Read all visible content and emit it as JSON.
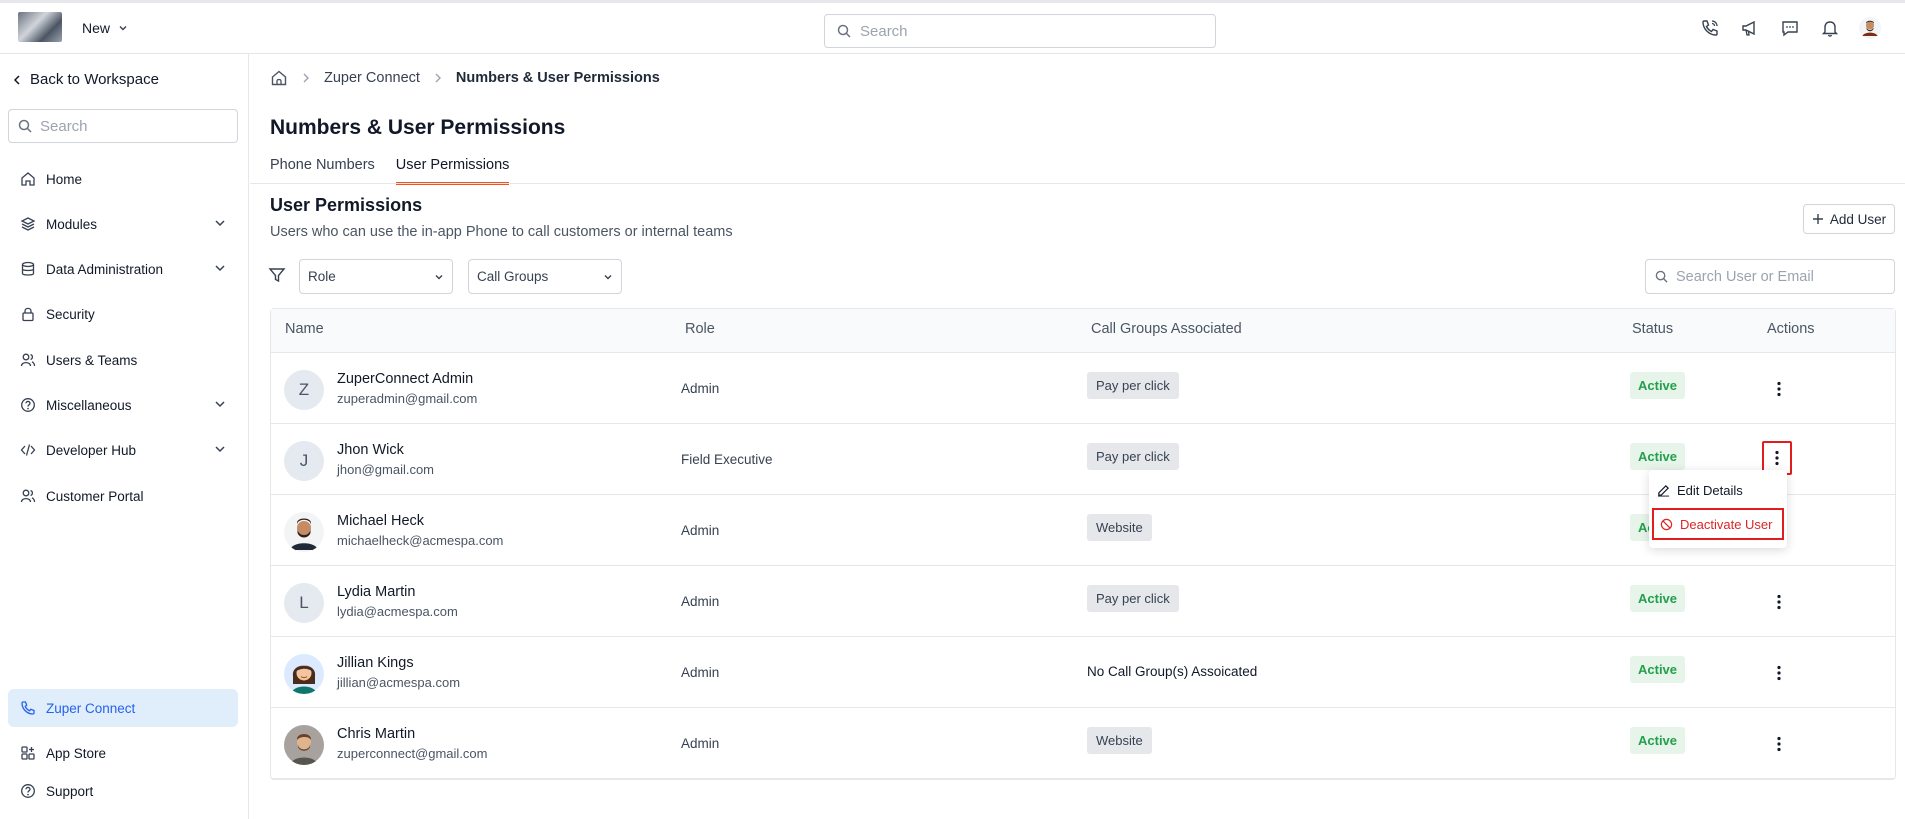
{
  "topbar": {
    "new_label": "New",
    "search_placeholder": "Search"
  },
  "sidebar": {
    "back_label": "Back to Workspace",
    "search_placeholder": "Search",
    "items": [
      {
        "label": "Home",
        "icon": "home-icon"
      },
      {
        "label": "Modules",
        "icon": "layers-icon",
        "expandable": true
      },
      {
        "label": "Data Administration",
        "icon": "database-icon",
        "expandable": true
      },
      {
        "label": "Security",
        "icon": "lock-icon"
      },
      {
        "label": "Users & Teams",
        "icon": "users-icon"
      },
      {
        "label": "Miscellaneous",
        "icon": "help-circle-icon",
        "expandable": true
      },
      {
        "label": "Developer Hub",
        "icon": "code-icon",
        "expandable": true
      },
      {
        "label": "Customer Portal",
        "icon": "users-icon"
      }
    ],
    "bottom": [
      {
        "label": "Zuper Connect",
        "icon": "phone-icon",
        "active": true
      },
      {
        "label": "App Store",
        "icon": "apps-icon"
      },
      {
        "label": "Support",
        "icon": "help-circle-icon"
      }
    ]
  },
  "breadcrumb": {
    "items": [
      "Zuper Connect",
      "Numbers & User Permissions"
    ]
  },
  "page": {
    "title": "Numbers & User Permissions",
    "tabs": [
      "Phone Numbers",
      "User Permissions"
    ],
    "active_tab": "User Permissions"
  },
  "section": {
    "title": "User Permissions",
    "subtitle": "Users who can use the in-app Phone to call customers or internal teams",
    "add_user_label": "Add User"
  },
  "filters": {
    "role_label": "Role",
    "call_groups_label": "Call Groups",
    "search_placeholder": "Search User or Email"
  },
  "table": {
    "headers": [
      "Name",
      "Role",
      "Call Groups Associated",
      "Status",
      "Actions"
    ],
    "rows": [
      {
        "initial": "Z",
        "name": "ZuperConnect Admin",
        "email": "zuperadmin@gmail.com",
        "role": "Admin",
        "call_group": "Pay per click",
        "chip": true,
        "status": "Active"
      },
      {
        "initial": "J",
        "name": "Jhon Wick",
        "email": "jhon@gmail.com",
        "role": "Field Executive",
        "call_group": "Pay per click",
        "chip": true,
        "status": "Active"
      },
      {
        "initial": "",
        "name": "Michael Heck",
        "email": "michaelheck@acmespa.com",
        "role": "Admin",
        "call_group": "Website",
        "chip": true,
        "status": "Active"
      },
      {
        "initial": "L",
        "name": "Lydia Martin",
        "email": "lydia@acmespa.com",
        "role": "Admin",
        "call_group": "Pay per click",
        "chip": true,
        "status": "Active"
      },
      {
        "initial": "",
        "name": "Jillian Kings",
        "email": "jillian@acmespa.com",
        "role": "Admin",
        "call_group": "No Call Group(s) Assoicated",
        "chip": false,
        "status": "Active"
      },
      {
        "initial": "",
        "name": "Chris Martin",
        "email": "zuperconnect@gmail.com",
        "role": "Admin",
        "call_group": "Website",
        "chip": true,
        "status": "Active"
      }
    ]
  },
  "actions_menu": {
    "edit_label": "Edit Details",
    "deactivate_label": "Deactivate User"
  },
  "colors": {
    "accent_tab": "#f4511e",
    "status_green": "#22a04b",
    "danger": "#dc2626",
    "active_nav_bg": "#e0edfb"
  }
}
